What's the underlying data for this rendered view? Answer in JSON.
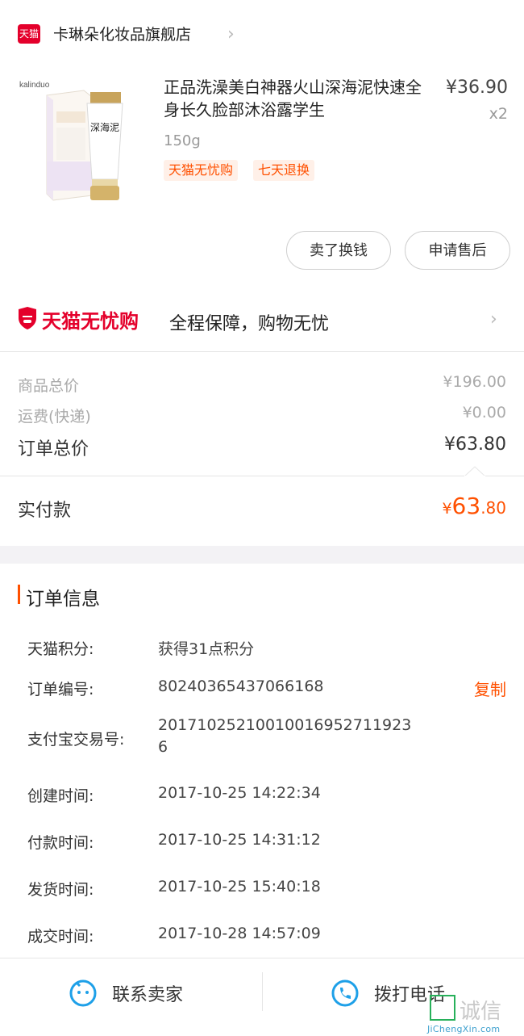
{
  "shop": {
    "badge": "天猫",
    "name": "卡琳朵化妆品旗舰店"
  },
  "product": {
    "brand": "kalinduo",
    "tube_text": "深海泥",
    "title": "正品洗澡美白神器火山深海泥快速全身长久脸部沐浴露学生",
    "spec": "150g",
    "price": "¥36.90",
    "qty": "x2",
    "tags": [
      "天猫无忧购",
      "七天退换"
    ]
  },
  "actions": {
    "sell": "卖了换钱",
    "after_sales": "申请售后"
  },
  "guarantee": {
    "logo": "天猫无忧购",
    "desc": "全程保障，购物无忧"
  },
  "summary": {
    "goods_label": "商品总价",
    "goods_value": "¥196.00",
    "shipping_label": "运费(快递)",
    "shipping_value": "¥0.00",
    "total_label": "订单总价",
    "total_value": "¥63.80"
  },
  "payment": {
    "label": "实付款",
    "currency": "¥",
    "int": "63",
    "dec": ".80"
  },
  "order_info": {
    "title": "订单信息",
    "copy": "复制",
    "rows": [
      {
        "label": "天猫积分:",
        "value": "获得31点积分"
      },
      {
        "label": "订单编号:",
        "value": "80240365437066168"
      },
      {
        "label": "支付宝交易号:",
        "value": "20171025210010016952711923",
        "value2": "6"
      },
      {
        "label": "创建时间:",
        "value": "2017-10-25 14:22:34"
      },
      {
        "label": "付款时间:",
        "value": "2017-10-25 14:31:12"
      },
      {
        "label": "发货时间:",
        "value": "2017-10-25 15:40:18"
      },
      {
        "label": "成交时间:",
        "value": "2017-10-28 14:57:09"
      }
    ]
  },
  "bottom": {
    "contact": "联系卖家",
    "call": "拨打电话"
  },
  "watermark": {
    "chars": "诚信",
    "url": "JiChengXin.com"
  },
  "colors": {
    "accent": "#ff5000",
    "tmall_red": "#e4002b",
    "bg_band": "#f3f2f5"
  }
}
